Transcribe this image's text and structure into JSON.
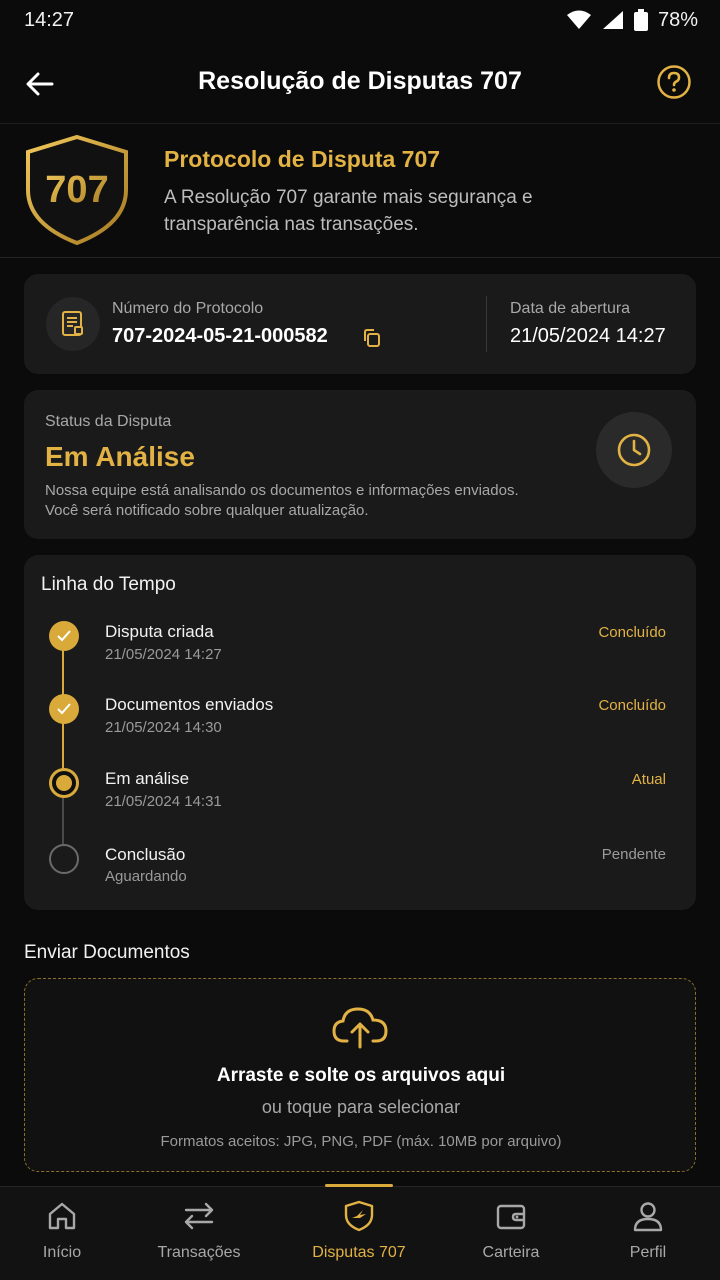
{
  "status_bar": {
    "time": "14:27",
    "battery": "78%"
  },
  "header": {
    "title": "Resolução de Disputas 707"
  },
  "hero": {
    "badge_text": "707",
    "title": "Protocolo de Disputa 707",
    "description": "A Resolução 707 garante mais segurança e transparência nas transações."
  },
  "protocol": {
    "number_label": "Número do Protocolo",
    "number": "707-2024-05-21-000582",
    "date_label": "Data de abertura",
    "date": "21/05/2024 14:27"
  },
  "dispute_status": {
    "label": "Status da Disputa",
    "value": "Em Análise",
    "description": "Nossa equipe está analisando os documentos e informações enviados. Você será notificado sobre qualquer atualização."
  },
  "timeline": {
    "title": "Linha do Tempo",
    "steps": [
      {
        "title": "Disputa criada",
        "date": "21/05/2024 14:27",
        "state": "Concluído"
      },
      {
        "title": "Documentos enviados",
        "date": "21/05/2024 14:30",
        "state": "Concluído"
      },
      {
        "title": "Em análise",
        "date": "21/05/2024 14:31",
        "state": "Atual"
      },
      {
        "title": "Conclusão",
        "date": "Aguardando",
        "state": "Pendente"
      }
    ]
  },
  "upload": {
    "section_title": "Enviar Documentos",
    "main_text": "Arraste e solte os arquivos aqui",
    "sub_text": "ou toque para selecionar",
    "formats": "Formatos aceitos: JPG, PNG, PDF (máx. 10MB por arquivo)"
  },
  "nav": {
    "items": [
      {
        "label": "Início",
        "icon": "home-icon"
      },
      {
        "label": "Transações",
        "icon": "transfer-icon"
      },
      {
        "label": "Disputas 707",
        "icon": "shield-707-icon"
      },
      {
        "label": "Carteira",
        "icon": "wallet-icon"
      },
      {
        "label": "Perfil",
        "icon": "profile-icon"
      }
    ],
    "active_index": 2
  },
  "colors": {
    "accent": "#e2b244",
    "background": "#0b0b0b",
    "card": "#1a1a1a"
  }
}
